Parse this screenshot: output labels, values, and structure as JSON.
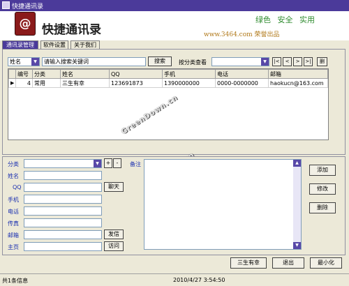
{
  "window": {
    "title": "快捷通讯录"
  },
  "banner": {
    "logo_glyph": "@",
    "app_title": "快捷通讯录",
    "slogan": "绿色 安全 实用",
    "publisher": "www.3464.com 荣誉出品"
  },
  "tabs": [
    {
      "label": "通讯录管理",
      "active": true
    },
    {
      "label": "软件设置",
      "active": false
    },
    {
      "label": "关于我们",
      "active": false
    }
  ],
  "search": {
    "field_select": "姓名",
    "keyword_value": "请输入搜索关键词",
    "search_button": "搜索",
    "category_label": "按分类查看",
    "category_select": "",
    "nav": {
      "first": "|<",
      "prev": "<",
      "next": ">",
      "last": ">|",
      "delete": "删"
    }
  },
  "table": {
    "columns": [
      "编号",
      "分类",
      "姓名",
      "QQ",
      "手机",
      "电话",
      "邮箱"
    ],
    "rows": [
      {
        "marker": "▶",
        "id": "4",
        "category": "常用",
        "name": "三生有幸",
        "qq": "123691873",
        "mobile": "1390000000",
        "phone": "0000-0000000",
        "email": "haokucn@163.com"
      }
    ]
  },
  "watermark": "GreenDown.cn",
  "form": {
    "category_label": "分类",
    "category_value": "",
    "add_category": "+",
    "remove_category": "-",
    "name_label": "姓名",
    "qq_label": "QQ",
    "chat_button": "聊天",
    "mobile_label": "手机",
    "phone_label": "电话",
    "fax_label": "传真",
    "email_label": "邮箱",
    "send_mail_button": "发信",
    "homepage_label": "主页",
    "visit_button": "访问",
    "notes_label": "备注",
    "add_button": "添加",
    "modify_button": "修改",
    "delete_button": "删除"
  },
  "bottom_buttons": {
    "current_contact": "三生有幸",
    "exit": "退出",
    "minimize": "最小化"
  },
  "status": {
    "count_text": "共1条信息",
    "datetime": "2010/4/27 3:54:50"
  },
  "colors": {
    "title_bar": "#4b3a9a",
    "slogan": "#2e8b2e",
    "publisher": "#b07818",
    "label_blue": "#1a2fb0",
    "logo": "#8a1a1a"
  }
}
